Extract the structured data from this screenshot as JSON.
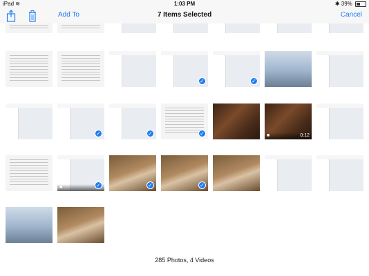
{
  "status": {
    "device": "iPad",
    "time": "1:03 PM",
    "battery": "39%",
    "battery_level": 0.39
  },
  "nav": {
    "add_to": "Add To",
    "title": "7 Items Selected",
    "cancel": "Cancel"
  },
  "footer": {
    "count": "285 Photos, 4 Videos"
  },
  "thumbs": [
    {
      "kind": "page",
      "selected": false
    },
    {
      "kind": "page",
      "selected": false
    },
    {
      "kind": "screen",
      "selected": false
    },
    {
      "kind": "screen",
      "selected": false
    },
    {
      "kind": "screen",
      "selected": false
    },
    {
      "kind": "screen",
      "selected": false
    },
    {
      "kind": "screen",
      "selected": false
    },
    {
      "kind": "page",
      "selected": false
    },
    {
      "kind": "page",
      "selected": false
    },
    {
      "kind": "screen",
      "selected": false
    },
    {
      "kind": "screen",
      "selected": true
    },
    {
      "kind": "screen",
      "selected": true
    },
    {
      "kind": "sky",
      "selected": false
    },
    {
      "kind": "screen",
      "selected": false
    },
    {
      "kind": "screen",
      "selected": false
    },
    {
      "kind": "screen",
      "selected": true
    },
    {
      "kind": "screen",
      "selected": true
    },
    {
      "kind": "page",
      "selected": true
    },
    {
      "kind": "floor",
      "selected": false
    },
    {
      "kind": "floor",
      "selected": false,
      "video": "0:12"
    },
    {
      "kind": "screen",
      "selected": false
    },
    {
      "kind": "page",
      "selected": false
    },
    {
      "kind": "screen",
      "selected": true,
      "video": ""
    },
    {
      "kind": "cat",
      "selected": true
    },
    {
      "kind": "cat",
      "selected": true
    },
    {
      "kind": "cat",
      "selected": false
    },
    {
      "kind": "screen",
      "selected": false
    },
    {
      "kind": "screen",
      "selected": false
    },
    {
      "kind": "sky",
      "selected": false
    },
    {
      "kind": "cat",
      "selected": false
    }
  ],
  "colors": {
    "accent": "#1f7cf0"
  }
}
